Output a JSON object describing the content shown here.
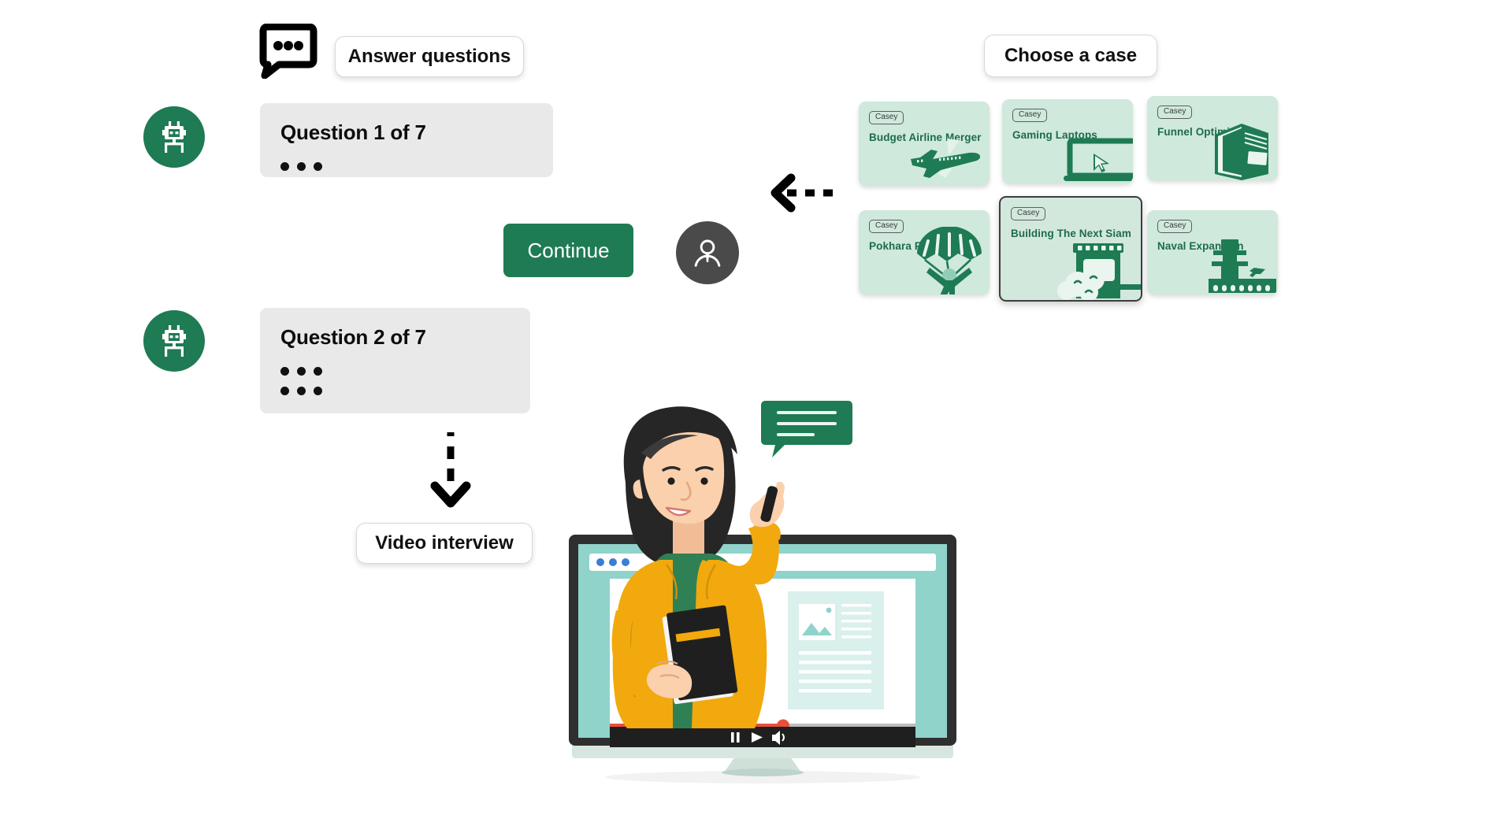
{
  "labels": {
    "answer_questions": "Answer questions",
    "choose_a_case": "Choose a case",
    "video_interview": "Video interview"
  },
  "icons": {
    "chat_bubble": "chat-bubble-dots-icon",
    "robot": "robot-icon",
    "user": "user-avatar-icon",
    "cursor": "mouse-cursor-icon",
    "arrow_left": "dashed-arrow-left-icon",
    "arrow_down": "dashed-arrow-down-icon"
  },
  "questions": [
    {
      "title": "Question 1 of 7",
      "dot_rows": 1
    },
    {
      "title": "Question 2 of 7",
      "dot_rows": 2
    }
  ],
  "continue_button": {
    "label": "Continue"
  },
  "cases": [
    {
      "badge": "Casey",
      "title": "Budget Airline Merger",
      "art": "airplane-icon",
      "selected": false
    },
    {
      "badge": "Casey",
      "title": "Gaming Laptops",
      "art": "laptop-icon",
      "selected": false
    },
    {
      "badge": "Casey",
      "title": "Funnel Optimization",
      "art": "book-icon",
      "selected": false
    },
    {
      "badge": "Casey",
      "title": "Pokhara Free Flight",
      "art": "paraglider-icon",
      "selected": false
    },
    {
      "badge": "Casey",
      "title": "Building The Next Siam",
      "art": "factory-icon",
      "selected": true
    },
    {
      "badge": "Casey",
      "title": "Naval Expansion",
      "art": "naval-base-icon",
      "selected": false
    }
  ],
  "video_player": {
    "controls": [
      "pause-icon",
      "play-icon",
      "volume-icon"
    ],
    "progress_percent": 60
  },
  "colors": {
    "brand_green": "#1e7b54",
    "card_green": "#cfe9dc",
    "card_title_green": "#1e6b4e",
    "question_card_gray": "#e9e9e9",
    "avatar_gray": "#4a4a4a",
    "screen_teal": "#8fd3cb",
    "jacket_yellow": "#f2a90e",
    "progress_red": "#e8503a"
  }
}
